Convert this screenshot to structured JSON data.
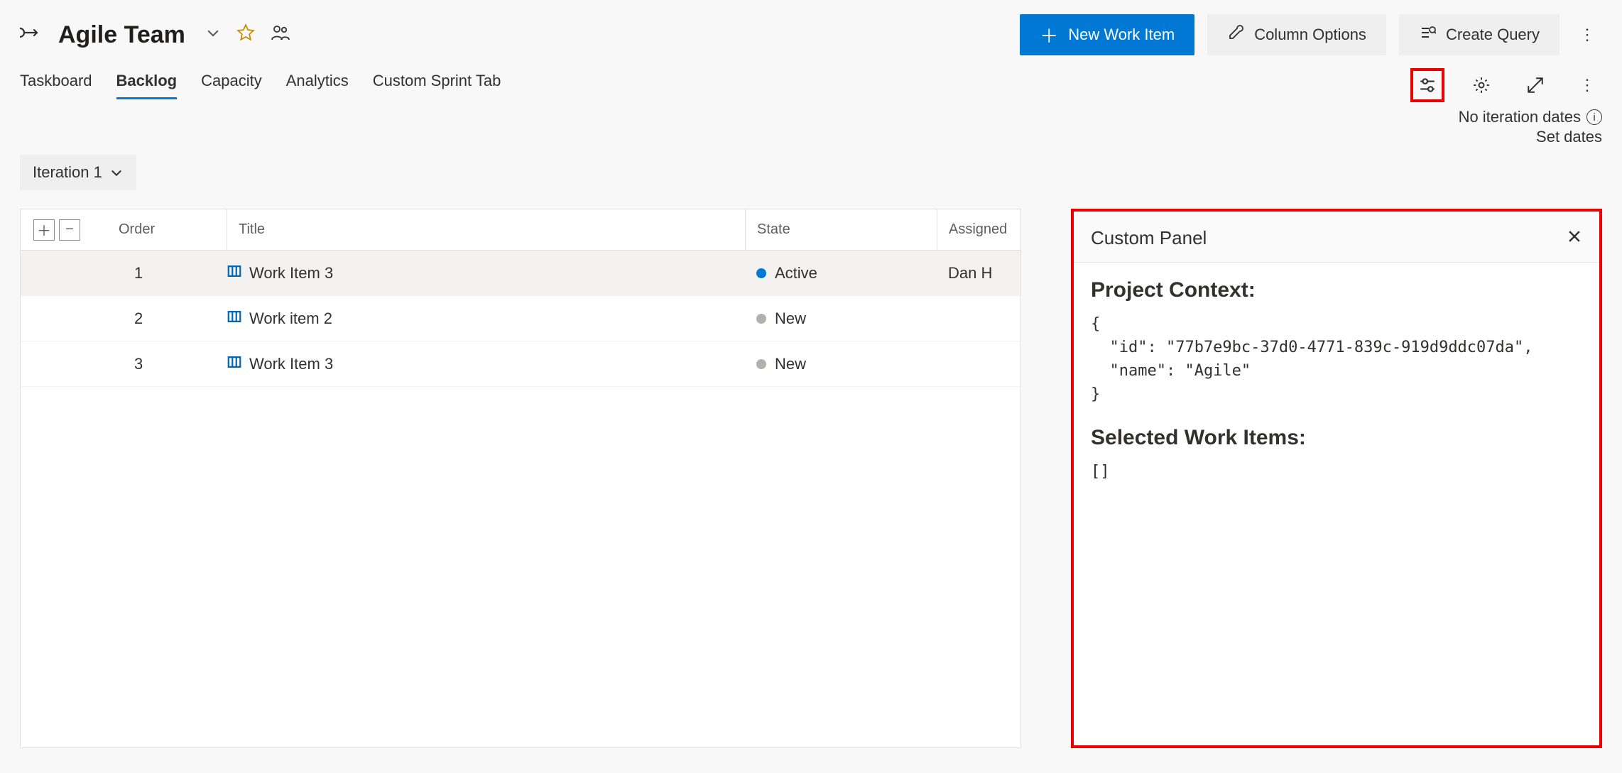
{
  "header": {
    "team_title": "Agile Team"
  },
  "buttons": {
    "new_work_item": "New Work Item",
    "column_options": "Column Options",
    "create_query": "Create Query"
  },
  "tabs": [
    {
      "label": "Taskboard",
      "active": false
    },
    {
      "label": "Backlog",
      "active": true
    },
    {
      "label": "Capacity",
      "active": false
    },
    {
      "label": "Analytics",
      "active": false
    },
    {
      "label": "Custom Sprint Tab",
      "active": false
    }
  ],
  "dates": {
    "no_dates": "No iteration dates",
    "set_dates": "Set dates"
  },
  "iteration": {
    "label": "Iteration 1"
  },
  "grid": {
    "columns": {
      "order": "Order",
      "title": "Title",
      "state": "State",
      "assigned": "Assigned"
    },
    "rows": [
      {
        "order": "1",
        "title": "Work Item 3",
        "state": "Active",
        "state_color": "dot-active",
        "assigned": "Dan H",
        "selected": true
      },
      {
        "order": "2",
        "title": "Work item 2",
        "state": "New",
        "state_color": "dot-new",
        "assigned": "",
        "selected": false
      },
      {
        "order": "3",
        "title": "Work Item 3",
        "state": "New",
        "state_color": "dot-new",
        "assigned": "",
        "selected": false
      }
    ]
  },
  "panel": {
    "title": "Custom Panel",
    "section1_title": "Project Context:",
    "section1_body": "{\n  \"id\": \"77b7e9bc-37d0-4771-839c-919d9ddc07da\",\n  \"name\": \"Agile\"\n}",
    "section2_title": "Selected Work Items:",
    "section2_body": "[]"
  }
}
